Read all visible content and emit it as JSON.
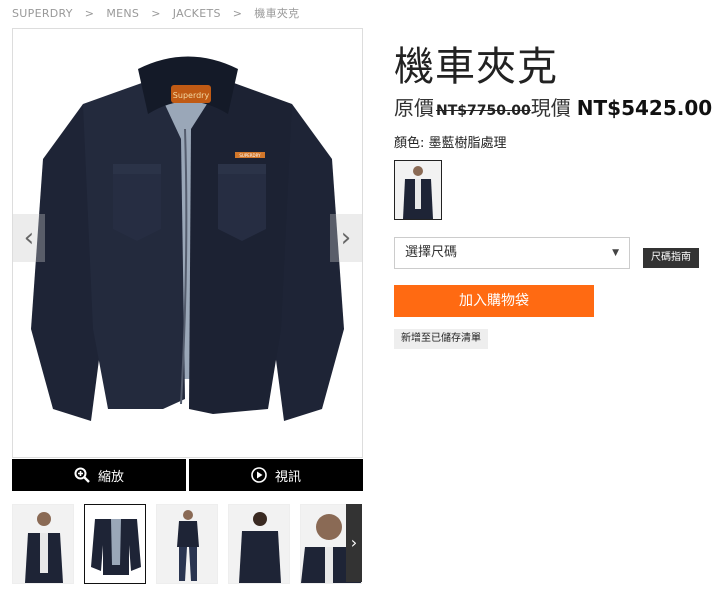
{
  "breadcrumb": {
    "items": [
      "SUPERDRY",
      "MENS",
      "JACKETS",
      "機車夾克"
    ],
    "separator": ">"
  },
  "product": {
    "title": "機車夾克",
    "original_label": "原價",
    "original_price": "NT$7750.00",
    "current_label": "現價",
    "current_price": "NT$5425.00",
    "color_text": "顏色: 墨藍樹脂處理"
  },
  "gallery": {
    "prev_arrow": "‹",
    "next_arrow": "›",
    "zoom_label": "縮放",
    "video_label": "視訊",
    "thumb_next": "›",
    "brand_patch": "Superdry",
    "brand_tag": "SUPERDRY"
  },
  "buy": {
    "size_select_text": "選擇尺碼",
    "size_guide_label": "尺碼指南",
    "add_to_cart_label": "加入購物袋",
    "wishlist_label": "新增至已儲存清單"
  },
  "colors": {
    "accent": "#ff6a12",
    "jacket": "#1e2436",
    "lining": "#9aa7b8",
    "button_bg": "#000000"
  }
}
